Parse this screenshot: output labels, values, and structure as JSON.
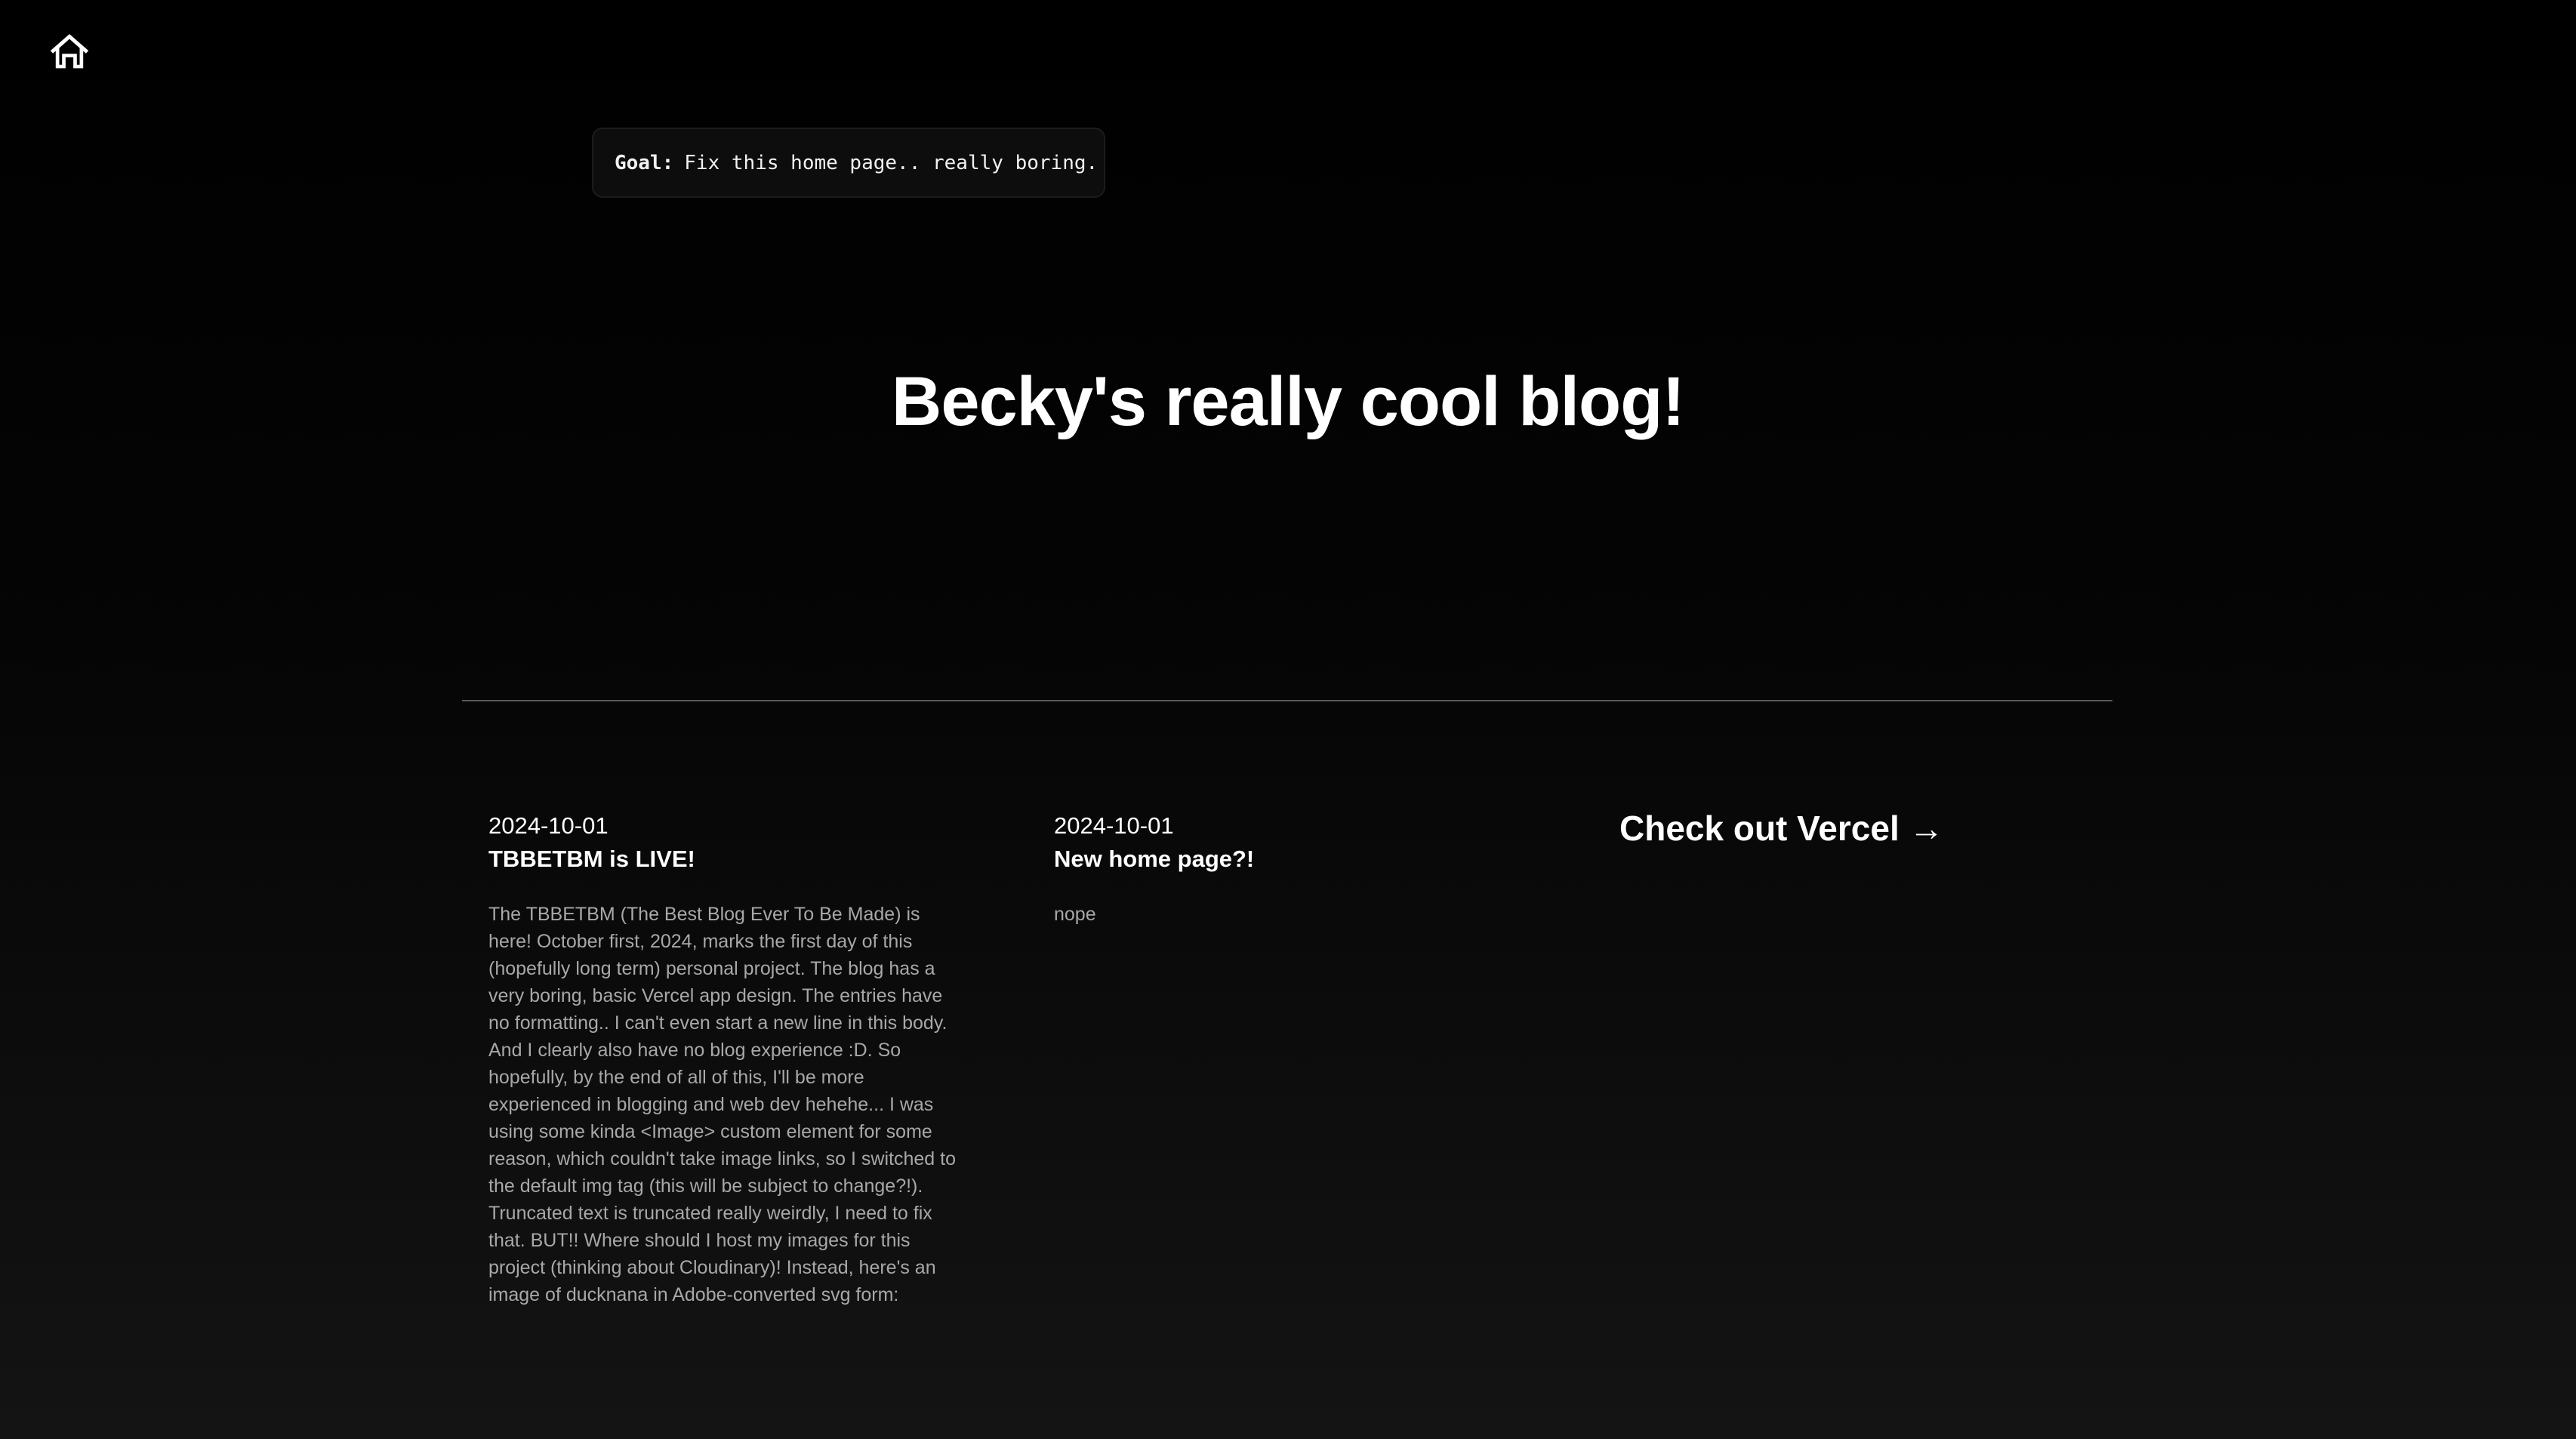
{
  "nav": {
    "home_icon": "home-icon"
  },
  "goal": {
    "label": "Goal:",
    "text": "Fix this home page.. really boring."
  },
  "header": {
    "title": "Becky's really cool blog!"
  },
  "posts": [
    {
      "date": "2024-10-01",
      "title": "TBBETBM is LIVE!",
      "body": "The TBBETBM (The Best Blog Ever To Be Made) is here! October first, 2024, marks the first day of this (hopefully long term) personal project. The blog has a very boring, basic Vercel app design. The entries have no formatting.. I can't even start a new line in this body. And I clearly also have no blog experience :D. So hopefully, by the end of all of this, I'll be more experienced in blogging and web dev hehehe... I was using some kinda <Image> custom element for some reason, which couldn't take image links, so I switched to the default img tag (this will be subject to change?!). Truncated text is truncated really weirdly, I need to fix that. BUT!! Where should I host my images for this project (thinking about Cloudinary)! Instead, here's an image of ducknana in Adobe-converted svg form:"
    },
    {
      "date": "2024-10-01",
      "title": "New home page?!",
      "body": "nope"
    }
  ],
  "cta": {
    "label": "Check out Vercel →"
  }
}
